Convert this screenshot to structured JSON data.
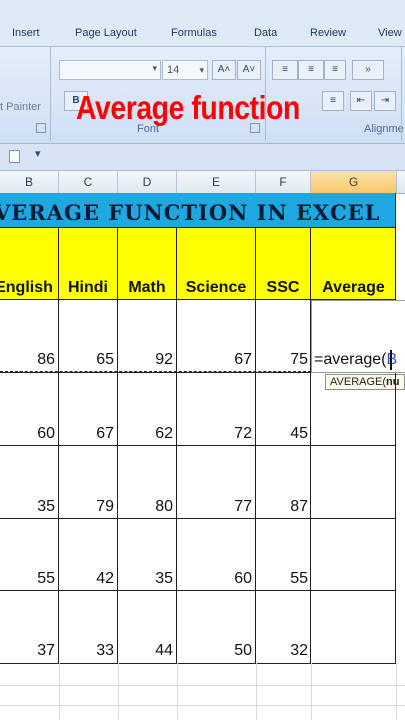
{
  "ribbon": {
    "tabs": [
      "Insert",
      "Page Layout",
      "Formulas",
      "Data",
      "Review",
      "View"
    ],
    "font_size": "14",
    "font_group_label": "Font",
    "alignment_group_label": "Alignme",
    "clipboard_label": "t Painter",
    "grow_font_label": "A˄",
    "shrink_font_label": "A˅"
  },
  "overlay_title": "Average function",
  "columns": [
    "B",
    "C",
    "D",
    "E",
    "F",
    "G"
  ],
  "sheet": {
    "title": "VERAGE FUNCTION IN EXCEL",
    "headers": [
      "English",
      "Hindi",
      "Math",
      "Science",
      "SSC",
      "Average"
    ],
    "rows": [
      [
        "86",
        "65",
        "92",
        "67",
        "75"
      ],
      [
        "60",
        "67",
        "62",
        "72",
        "45"
      ],
      [
        "35",
        "79",
        "80",
        "77",
        "87"
      ],
      [
        "55",
        "42",
        "35",
        "60",
        "55"
      ],
      [
        "37",
        "33",
        "44",
        "50",
        "32"
      ]
    ],
    "formula_text": "=average(",
    "formula_ref": "B",
    "tooltip": "AVERAGE(",
    "tooltip_arg": "nu"
  },
  "colors": {
    "title_bg": "#1ea7e0",
    "header_bg": "#ffff00",
    "overlay": "#ff0000",
    "selected_column": "#f7c86a"
  }
}
